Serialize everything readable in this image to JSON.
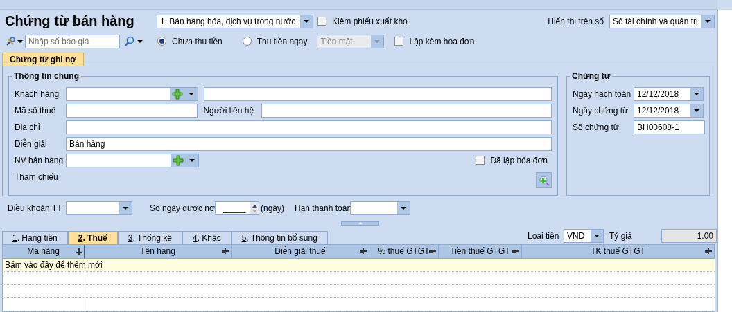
{
  "title": "Chứng từ bán hàng",
  "voucher_type": {
    "value": "1. Bán hàng hóa, dịch vụ trong nước"
  },
  "export_slip": {
    "label": "Kiêm phiếu xuất kho",
    "checked": false
  },
  "display_on_book": {
    "label": "Hiển thị trên sổ",
    "value": "Sổ tài chính và quản trị"
  },
  "quote_search": {
    "placeholder": "Nhập số báo giá"
  },
  "payment": [
    {
      "label": "Chưa thu tiền",
      "selected": true
    },
    {
      "label": "Thu tiền ngay",
      "selected": false
    }
  ],
  "payment_method": {
    "value": "Tiền mặt",
    "disabled": true
  },
  "invoice_with": {
    "label": "Lập kèm hóa đơn",
    "checked": false
  },
  "top_tabs": [
    {
      "label": "Chứng từ ghi nợ",
      "selected": true
    }
  ],
  "general": {
    "title": "Thông tin chung",
    "customer": {
      "label": "Khách hàng"
    },
    "tax_code": {
      "label": "Mã số thuế"
    },
    "contact": {
      "label": "Người liên hệ"
    },
    "address": {
      "label": "Địa chỉ"
    },
    "description": {
      "label": "Diễn giải",
      "value": "Bán hàng"
    },
    "salesperson": {
      "label": "NV bán hàng"
    },
    "reference": {
      "label": "Tham chiếu"
    },
    "invoiced": {
      "label": "Đã lập hóa đơn",
      "checked": false
    }
  },
  "voucher": {
    "title": "Chứng từ",
    "fields": [
      {
        "label": "Ngày hạch toán",
        "value": "12/12/2018",
        "kind": "date"
      },
      {
        "label": "Ngày chứng từ",
        "value": "12/12/2018",
        "kind": "date"
      },
      {
        "label": "Số chứng từ",
        "value": "BH00608-1",
        "kind": "text"
      }
    ]
  },
  "terms": {
    "payment_terms": {
      "label": "Điều khoản TT"
    },
    "credit_days": {
      "label": "Số ngày được nợ",
      "value": "_____",
      "unit": "(ngày)"
    },
    "due_date": {
      "label": "Hạn thanh toán"
    }
  },
  "detail_tabs": [
    {
      "label": "1. Hàng tiền",
      "selected": false
    },
    {
      "label": "2. Thuế",
      "selected": true
    },
    {
      "label": "3. Thống kê",
      "selected": false
    },
    {
      "label": "4. Khác",
      "selected": false
    },
    {
      "label": "5. Thông tin bổ sung",
      "selected": false
    }
  ],
  "currency": {
    "label": "Loại tiền",
    "value": "VND"
  },
  "rate": {
    "label": "Tỷ giá",
    "value": "1.00"
  },
  "grid": {
    "columns": [
      {
        "label": "Mã hàng",
        "pinned": true
      },
      {
        "label": "Tên hàng",
        "pinned": false
      },
      {
        "label": "Diễn giải thuế",
        "pinned": false
      },
      {
        "label": "% thuế GTGT",
        "pinned": false
      },
      {
        "label": "Tiền thuế GTGT",
        "pinned": false
      },
      {
        "label": "TK thuế GTGT",
        "pinned": false
      }
    ],
    "new_row_hint": "Bấm vào đây để thêm mới"
  }
}
